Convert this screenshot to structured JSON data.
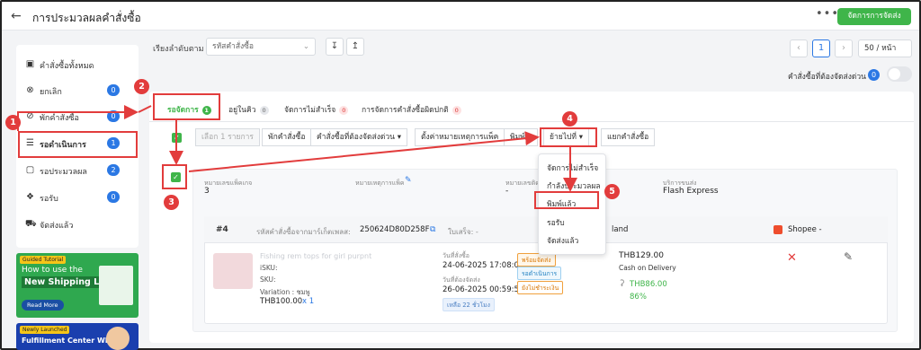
{
  "header": {
    "back_icon": "arrow-left-icon",
    "title": "การประมวลผลคำสั่งซื้อ",
    "more_label": "•••",
    "manage_button": "จัดการการจัดส่ง"
  },
  "sidebar": {
    "items": [
      {
        "label": "คำสั่งซื้อทั้งหมด",
        "icon": "box-icon",
        "badge": ""
      },
      {
        "label": "ยกเลิก",
        "icon": "cancel-circle-icon",
        "badge": "0"
      },
      {
        "label": "พักคำสั่งซื้อ",
        "icon": "pause-circle-icon",
        "badge": "0"
      },
      {
        "label": "รอดำเนินการ",
        "icon": "layers-icon",
        "badge": "1"
      },
      {
        "label": "รอประมวลผล",
        "icon": "clipboard-icon",
        "badge": "2"
      },
      {
        "label": "รอรับ",
        "icon": "handshake-icon",
        "badge": "0"
      },
      {
        "label": "จัดส่งแล้ว",
        "icon": "truck-icon",
        "badge": ""
      }
    ],
    "banner1": {
      "tag": "Guided Tutorial",
      "line1": "How to use the",
      "line2": "New Shipping Label?",
      "button": "Read More"
    },
    "banner2": {
      "tag": "Newly Launched",
      "line1": "Fulfillment Center WMS"
    }
  },
  "toolbar": {
    "sort_label": "เรียงลำดับตาม",
    "sort_placeholder": "รหัสคำสั่งซื้อ",
    "page_current": "1",
    "per_page": "50 / หน้า",
    "urgent_label": "คำสั่งซื้อที่ต้องจัดส่งด่วน",
    "urgent_count": "0"
  },
  "tabs": [
    {
      "label": "รอจัดการ",
      "count": "1"
    },
    {
      "label": "อยู่ในคิว",
      "count": "0"
    },
    {
      "label": "จัดการไม่สำเร็จ",
      "count": "0"
    },
    {
      "label": "การจัดการคำสั่งซื้อผิดปกติ",
      "count": "0"
    }
  ],
  "actions": {
    "selected": "เลือก 1 รายการ",
    "hold": "พักคำสั่งซื้อ",
    "urgent": "คำสั่งซื้อที่ต้องจัดส่งด่วน",
    "remark": "ตั้งค่าหมายเหตุการแพ็ค",
    "print": "พิมพ์",
    "move": "ย้ายไปที่",
    "split": "แยกคำสั่งซื้อ"
  },
  "move_menu": [
    "จัดการไม่สำเร็จ",
    "กำลังประมวลผล",
    "พิมพ์แล้ว",
    "รอรับ",
    "จัดส่งแล้ว"
  ],
  "annotations": [
    "1",
    "2",
    "3",
    "4",
    "5"
  ],
  "order_summary": {
    "package_label": "หมายเลขแพ็คเกจ",
    "package_value": "3",
    "remark_label": "หมายเหตุการแพ็ค",
    "tracking_label": "หมายเลขติด",
    "tracking_value": "-",
    "service_label": "บริการขนส่ง",
    "service_value": "Flash Express"
  },
  "order": {
    "index": "#4",
    "market_id_label": "รหัสคำสั่งซื้อจากมาร์เก็ตเพลส:",
    "market_id": "250624D80D258F",
    "invoice_label": "ใบเสร็จ: -",
    "country": "land",
    "store": "Shopee -",
    "product_name": "Fishing rem tops for girl purpnt",
    "isku_label": "iSKU:",
    "sku_label": "SKU:",
    "variation": "Variation : ชมพู",
    "price_qty": "THB100.00",
    "qty": "x 1",
    "order_date_label": "วันที่สั่งซื้อ",
    "order_date": "24-06-2025 17:08:00",
    "ship_by_label": "วันที่ต้องจัดส่ง",
    "ship_by": "26-06-2025 00:59:59",
    "remaining": "เหลือ 22 ชั่วโมง",
    "status_ready": "พร้อมจัดส่ง",
    "status_pending": "รอดำเนินการ",
    "status_unpaid": "ยังไม่ชำระเงิน",
    "total": "THB129.00",
    "payment": "Cash on Delivery",
    "profit": "THB86.00",
    "profit_pct": "86%"
  },
  "colors": {
    "accent": "#3fb54a",
    "badge": "#2b78e4",
    "annotation": "#e23c3c"
  }
}
